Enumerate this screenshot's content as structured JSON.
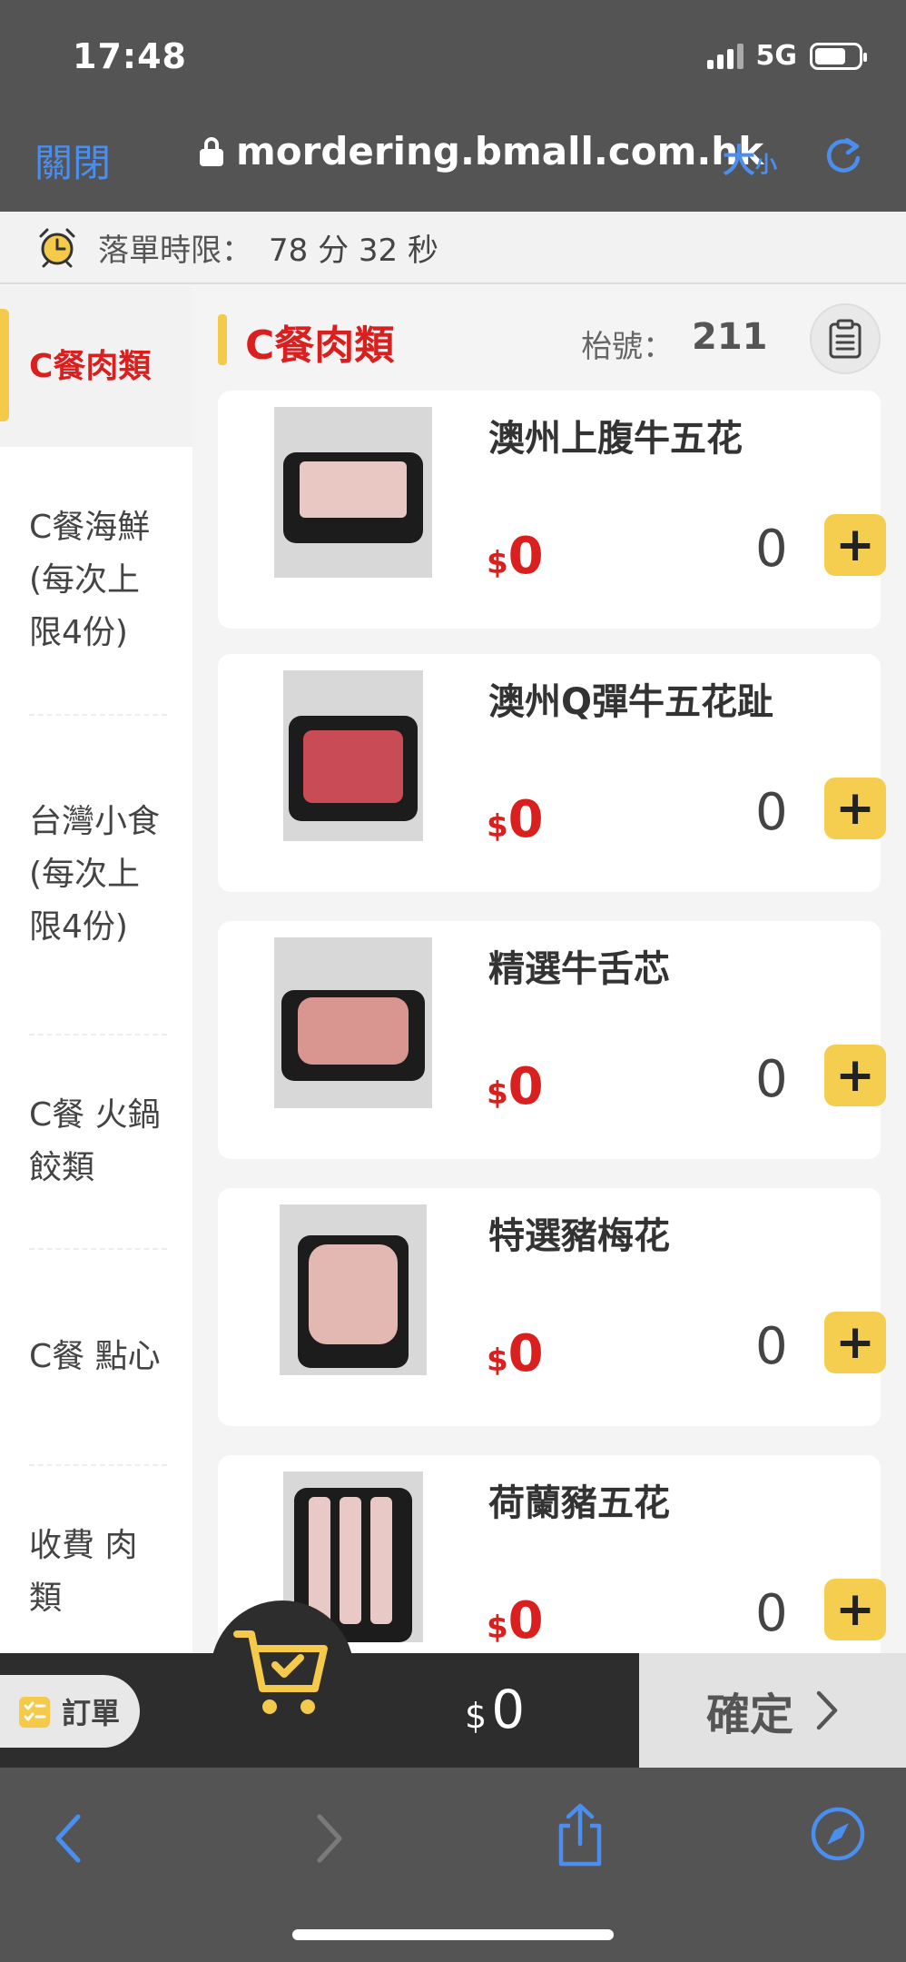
{
  "status_bar": {
    "time": "17:48",
    "network": "5G"
  },
  "browser": {
    "close_label": "關閉",
    "url": "mordering.bmall.com.hk",
    "text_size_big": "大",
    "text_size_small": "小"
  },
  "timer": {
    "label": "落單時限：",
    "value": "78 分 32 秒"
  },
  "sidebar": {
    "items": [
      {
        "label": "C餐肉類",
        "active": true
      },
      {
        "label": "C餐海鮮(每次上限4份)"
      },
      {
        "label": "台灣小食(每次上限4份)"
      },
      {
        "label": "C餐 火鍋餃類"
      },
      {
        "label": "C餐 點心"
      },
      {
        "label": "收費 肉類"
      }
    ]
  },
  "category": {
    "title": "C餐肉類",
    "table_label": "枱號：",
    "table_number": "211"
  },
  "products": [
    {
      "name": "澳州上腹牛五花",
      "currency": "$",
      "price": "0",
      "qty": "0",
      "add": "+"
    },
    {
      "name": "澳州Q彈牛五花趾",
      "currency": "$",
      "price": "0",
      "qty": "0",
      "add": "+"
    },
    {
      "name": "精選牛舌芯",
      "currency": "$",
      "price": "0",
      "qty": "0",
      "add": "+"
    },
    {
      "name": "特選豬梅花",
      "currency": "$",
      "price": "0",
      "qty": "0",
      "add": "+"
    },
    {
      "name": "荷蘭豬五花",
      "currency": "$",
      "price": "0",
      "qty": "0",
      "add": "+"
    }
  ],
  "cart": {
    "orders_label": "訂單",
    "currency": "$",
    "total": "0",
    "confirm_label": "確定"
  },
  "colors": {
    "accent_red": "#d9201f",
    "accent_yellow": "#f5cd4f",
    "link_blue": "#4a8ff0",
    "chrome_gray": "#545454",
    "bar_dark": "#2d2d2d"
  }
}
